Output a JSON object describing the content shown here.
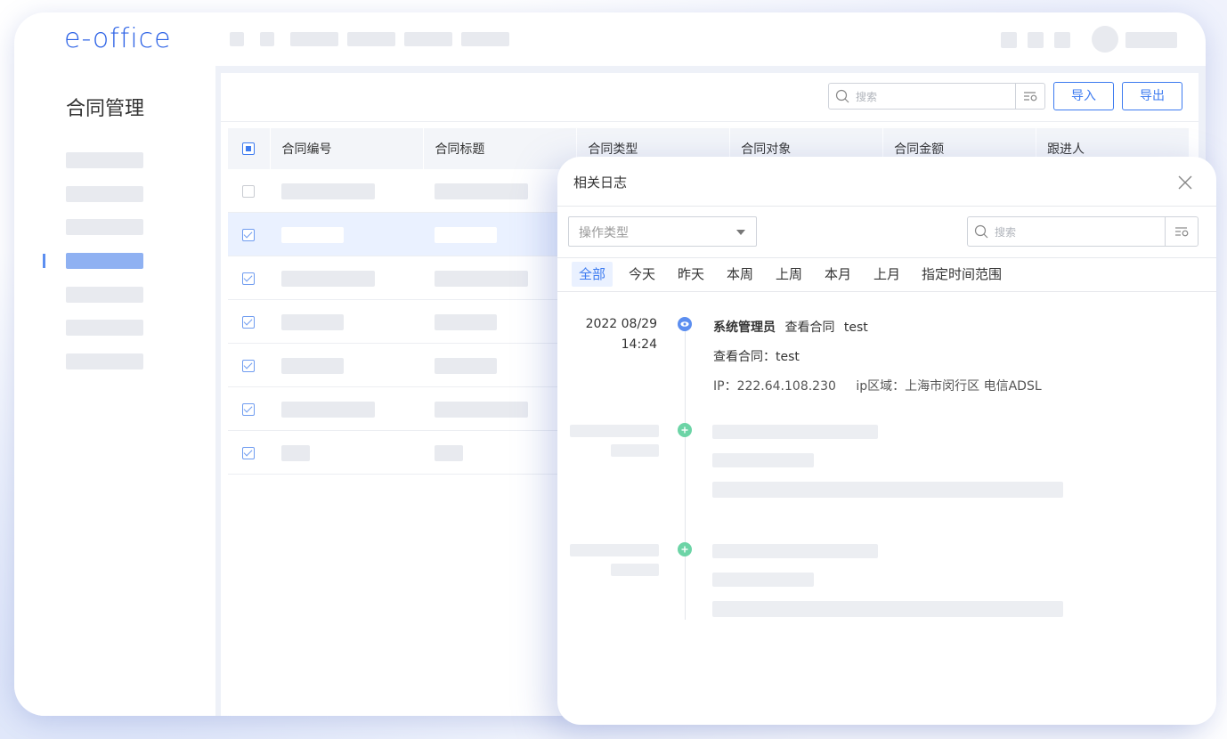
{
  "brand": {
    "logo": "e-office"
  },
  "sidebar": {
    "title": "合同管理"
  },
  "toolbar": {
    "search_placeholder": "搜索",
    "import_label": "导入",
    "export_label": "导出"
  },
  "table": {
    "columns": [
      "合同编号",
      "合同标题",
      "合同类型",
      "合同对象",
      "合同金额",
      "跟进人"
    ]
  },
  "log_panel": {
    "title": "相关日志",
    "type_select": "操作类型",
    "search_placeholder": "搜索",
    "tabs": [
      "全部",
      "今天",
      "昨天",
      "本周",
      "上周",
      "本月",
      "上月",
      "指定时间范围"
    ],
    "entry": {
      "date": "2022 08/29",
      "time": "14:24",
      "user": "系统管理员",
      "action": "查看合同",
      "target": "test",
      "detail": "查看合同：test",
      "ip": "IP：222.64.108.230",
      "region": "ip区域：上海市闵行区 电信ADSL"
    }
  },
  "colors": {
    "accent": "#3d7bf0",
    "timeline_dot_view": "#5c8ef0",
    "timeline_dot_add": "#6cd4a6"
  }
}
